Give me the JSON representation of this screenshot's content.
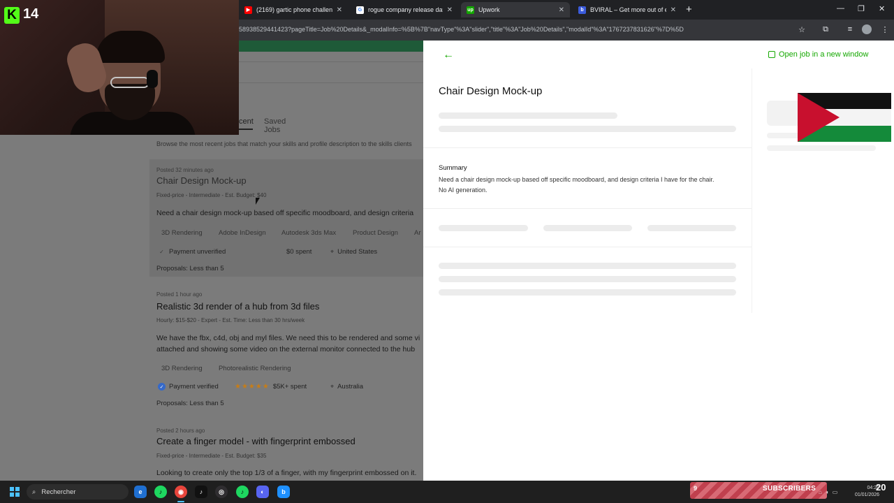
{
  "browser": {
    "tabs": [
      {
        "title": "(2169) gartic phone challenge",
        "favicon": "youtube-icon",
        "color": "#ff0000",
        "active": false
      },
      {
        "title": "rogue company release date -",
        "favicon": "google-icon",
        "color": "#ffffff",
        "active": false
      },
      {
        "title": "Upwork",
        "favicon": "upwork-icon",
        "color": "#14a800",
        "active": true
      },
      {
        "title": "BVIRAL – Get more out of ever",
        "favicon": "bviral-icon",
        "color": "#3b5bdb",
        "active": false
      }
    ],
    "new_tab": "+",
    "url": "58938529441423?pageTitle=Job%20Details&_modalInfo=%5B%7B\"navType\"%3A\"slider\",\"title\"%3A\"Job%20Details\",\"modalId\"%3A\"1767237831626\"%7D%5D",
    "window_controls": [
      "—",
      "❐",
      "✕"
    ]
  },
  "webcam": {
    "platform_icon": "kick-logo",
    "platform_letter": "K",
    "viewer_count": "14"
  },
  "background_page": {
    "tabs": {
      "recent": "cent",
      "saved": "Saved Jobs"
    },
    "browse_text": "Browse the most recent jobs that match your skills and profile description to the skills clients",
    "jobs": [
      {
        "posted": "Posted 32 minutes ago",
        "title": "Chair Design Mock-up",
        "meta": "Fixed-price - Intermediate - Est. Budget: $40",
        "desc": [
          "Need a chair design mock-up based off specific moodboard, and design criteria"
        ],
        "skills": [
          "3D Rendering",
          "Adobe InDesign",
          "Autodesk 3ds Max",
          "Product Design",
          "Ar"
        ],
        "payment": "Payment unverified",
        "spent": "$0 spent",
        "location": "United States",
        "proposals": "Proposals: Less than 5"
      },
      {
        "posted": "Posted 1 hour ago",
        "title": "Realistic 3d render of a hub from 3d files",
        "meta": "Hourly: $15-$20 - Expert - Est. Time: Less than 30 hrs/week",
        "desc": [
          "We have the fbx, c4d, obj and myl files. We need this to be rendered and some vi",
          "attached and showing some video on the external monitor connected to the hub"
        ],
        "skills": [
          "3D Rendering",
          "Photorealistic Rendering"
        ],
        "payment": "Payment verified",
        "stars": "★★★★★",
        "spent": "$5K+ spent",
        "location": "Australia",
        "proposals": "Proposals: Less than 5"
      },
      {
        "posted": "Posted 2 hours ago",
        "title": "Create a finger model - with fingerprint embossed",
        "meta": "Fixed-price - Intermediate - Est. Budget: $35",
        "desc": [
          "Looking to create only the top 1/3 of a finger, with my fingerprint embossed on it."
        ]
      }
    ]
  },
  "modal": {
    "back": "←",
    "open_job": "Open job in a new window",
    "title": "Chair Design Mock-up",
    "summary_label": "Summary",
    "summary_lines": [
      "Need a chair design mock-up based off specific moodboard, and design criteria I have for the chair.",
      "No AI generation."
    ]
  },
  "overlay": {
    "subscribers_label": "SUBSCRIBERS",
    "subscribers_badge": "9",
    "subscribers_count": "20"
  },
  "taskbar": {
    "search_label": "Rechercher",
    "apps": [
      "edge-icon",
      "spotify-icon",
      "chrome-icon",
      "tiktok-icon",
      "obs-icon",
      "spotify-icon",
      "discord-icon",
      "bviral-icon"
    ],
    "time": "04:20",
    "date": "01/01/2026"
  },
  "colors": {
    "upwork_green": "#14a800",
    "accent_blue": "#4cc2ff"
  }
}
